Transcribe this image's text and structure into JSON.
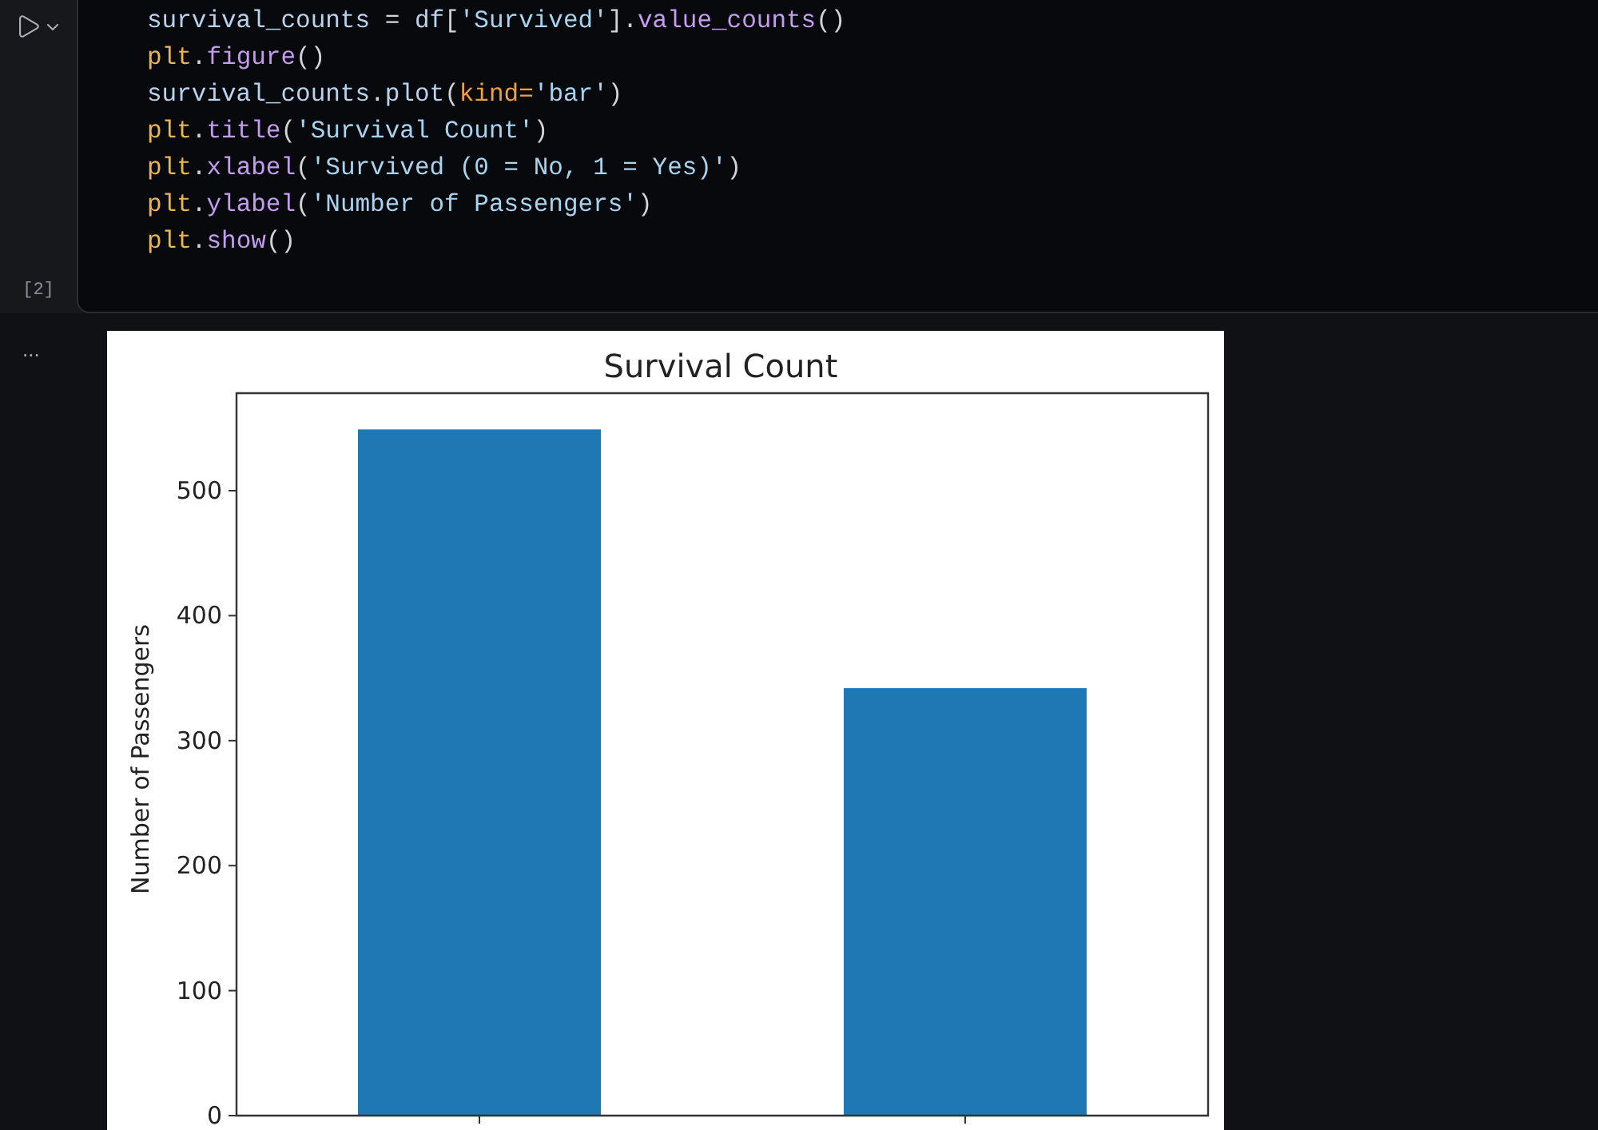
{
  "code_cell": {
    "execution_count": "[2]",
    "lines": [
      [
        {
          "kind": "var",
          "text": "survival_counts"
        },
        {
          "kind": "punc",
          "text": " = "
        },
        {
          "kind": "var",
          "text": "df"
        },
        {
          "kind": "punc",
          "text": "["
        },
        {
          "kind": "str",
          "text": "'Survived'"
        },
        {
          "kind": "punc",
          "text": "]."
        },
        {
          "kind": "fn",
          "text": "value_counts"
        },
        {
          "kind": "punc",
          "text": "()"
        }
      ],
      [
        {
          "kind": "obj",
          "text": "plt"
        },
        {
          "kind": "punc",
          "text": "."
        },
        {
          "kind": "fn",
          "text": "figure"
        },
        {
          "kind": "punc",
          "text": "()"
        }
      ],
      [
        {
          "kind": "var",
          "text": "survival_counts"
        },
        {
          "kind": "punc",
          "text": "."
        },
        {
          "kind": "var",
          "text": "plot"
        },
        {
          "kind": "punc",
          "text": "("
        },
        {
          "kind": "param",
          "text": "kind="
        },
        {
          "kind": "str",
          "text": "'bar'"
        },
        {
          "kind": "punc",
          "text": ")"
        }
      ],
      [
        {
          "kind": "obj",
          "text": "plt"
        },
        {
          "kind": "punc",
          "text": "."
        },
        {
          "kind": "fn",
          "text": "title"
        },
        {
          "kind": "punc",
          "text": "("
        },
        {
          "kind": "str",
          "text": "'Survival Count'"
        },
        {
          "kind": "punc",
          "text": ")"
        }
      ],
      [
        {
          "kind": "obj",
          "text": "plt"
        },
        {
          "kind": "punc",
          "text": "."
        },
        {
          "kind": "fn",
          "text": "xlabel"
        },
        {
          "kind": "punc",
          "text": "("
        },
        {
          "kind": "str",
          "text": "'Survived (0 = No, 1 = Yes)'"
        },
        {
          "kind": "punc",
          "text": ")"
        }
      ],
      [
        {
          "kind": "obj",
          "text": "plt"
        },
        {
          "kind": "punc",
          "text": "."
        },
        {
          "kind": "fn",
          "text": "ylabel"
        },
        {
          "kind": "punc",
          "text": "("
        },
        {
          "kind": "str",
          "text": "'Number of Passengers'"
        },
        {
          "kind": "punc",
          "text": ")"
        }
      ],
      [
        {
          "kind": "obj",
          "text": "plt"
        },
        {
          "kind": "punc",
          "text": "."
        },
        {
          "kind": "fn",
          "text": "show"
        },
        {
          "kind": "punc",
          "text": "()"
        }
      ]
    ]
  },
  "output": {
    "marker": "...",
    "chart_data": {
      "type": "bar",
      "title": "Survival Count",
      "ylabel": "Number of Passengers",
      "categories": [
        null,
        null
      ],
      "series": [
        {
          "color": "#1f77b4",
          "values": [
            549,
            342
          ]
        }
      ],
      "ylim": [
        0,
        578
      ],
      "yticks": [
        {
          "value": 0,
          "label": "0"
        },
        {
          "value": 100,
          "label": "100"
        },
        {
          "value": 200,
          "label": "200"
        },
        {
          "value": 300,
          "label": "300"
        },
        {
          "value": 400,
          "label": "400"
        },
        {
          "value": 500,
          "label": "500"
        }
      ]
    }
  }
}
